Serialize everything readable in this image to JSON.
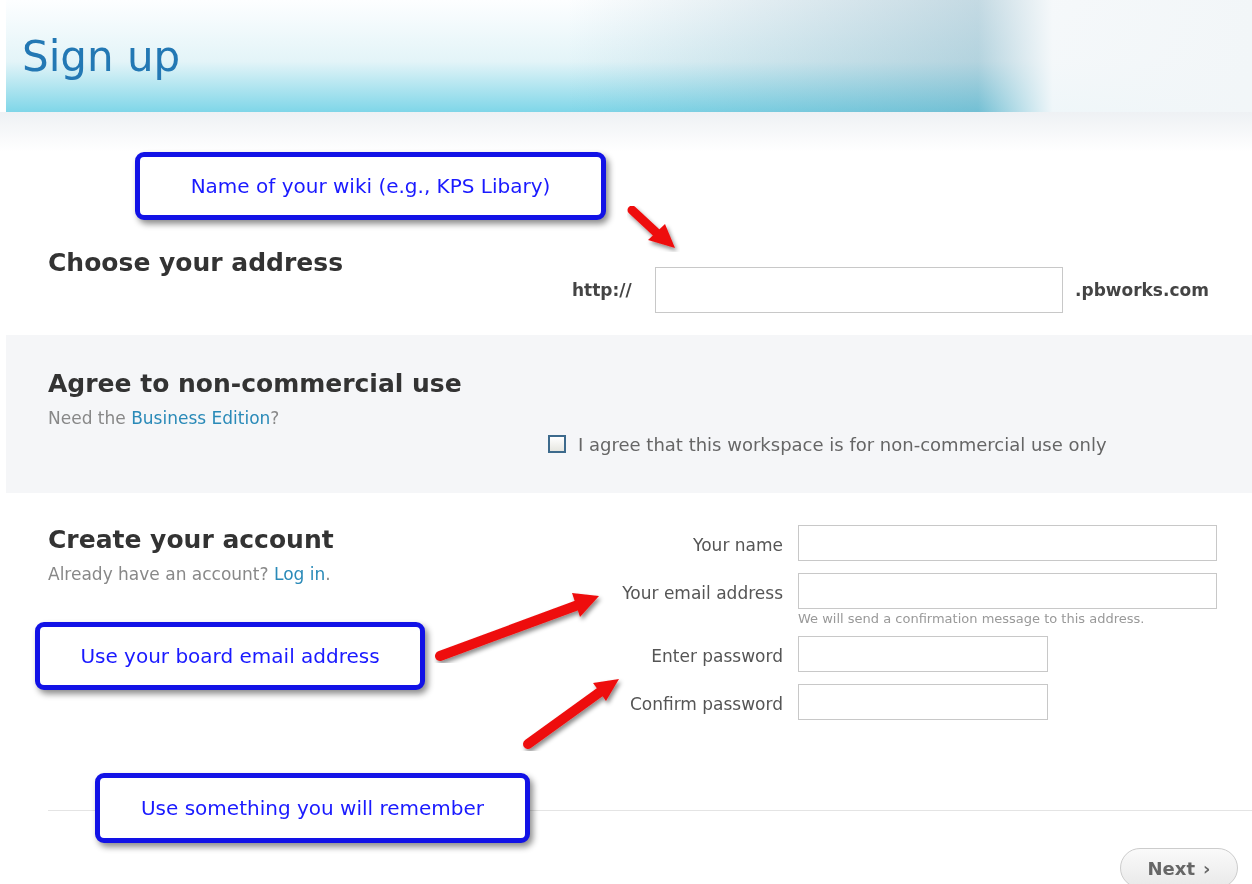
{
  "header": {
    "title": "Sign up"
  },
  "address": {
    "heading": "Choose your address",
    "prefix": "http://",
    "suffix": ".pbworks.com"
  },
  "agreement": {
    "heading": "Agree to non-commercial use",
    "note": "Need the ",
    "note_link": "Business Edition",
    "note_end": "?",
    "checkbox_label": "I agree that this workspace is for non-commercial use only",
    "checked": false
  },
  "account": {
    "heading": "Create your account",
    "note": "Already have an account? ",
    "note_link": "Log in",
    "note_end": ".",
    "fields": [
      {
        "label": "Your name",
        "kind": "wide"
      },
      {
        "label": "Your email address",
        "kind": "wide",
        "hint": "We will send a confirmation message to this address."
      },
      {
        "label": "Enter password",
        "kind": "short"
      },
      {
        "label": "Confirm password",
        "kind": "short"
      }
    ]
  },
  "next_button": {
    "label": "Next",
    "icon": "›"
  },
  "callouts": [
    {
      "text": "Name of your wiki (e.g., KPS Libary)"
    },
    {
      "text": "Use your board email address"
    },
    {
      "text": "Use something you will remember"
    }
  ]
}
